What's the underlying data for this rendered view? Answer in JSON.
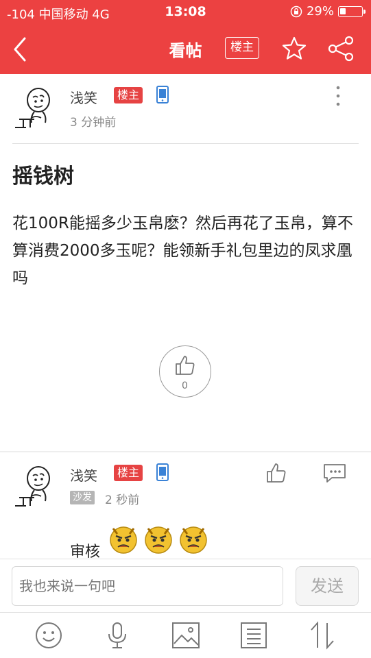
{
  "status_bar": {
    "signal": "-104 中国移动  4G",
    "time": "13:08",
    "battery": "29%",
    "battery_level": 0.29
  },
  "nav": {
    "title": "看帖",
    "owner_button": "楼主"
  },
  "post": {
    "author": "浅笑",
    "owner_badge": "楼主",
    "time": "3 分钟前",
    "title": "摇钱树",
    "body": "花100R能摇多少玉帛麽？然后再花了玉帛，算不算消费2000多玉呢？能领新手礼包里边的凤求凰吗",
    "like_count": "0"
  },
  "reply": {
    "author": "浅笑",
    "owner_badge": "楼主",
    "floor_badge": "沙发",
    "time": "2 秒前",
    "text": "审核"
  },
  "input": {
    "placeholder": "我也来说一句吧",
    "send_label": "发送"
  },
  "colors": {
    "brand_red": "#ec4141",
    "badge_red": "#e64343"
  },
  "toolbar_icons": [
    "smiley-icon",
    "microphone-icon",
    "image-icon",
    "list-icon",
    "sort-arrows-icon"
  ]
}
